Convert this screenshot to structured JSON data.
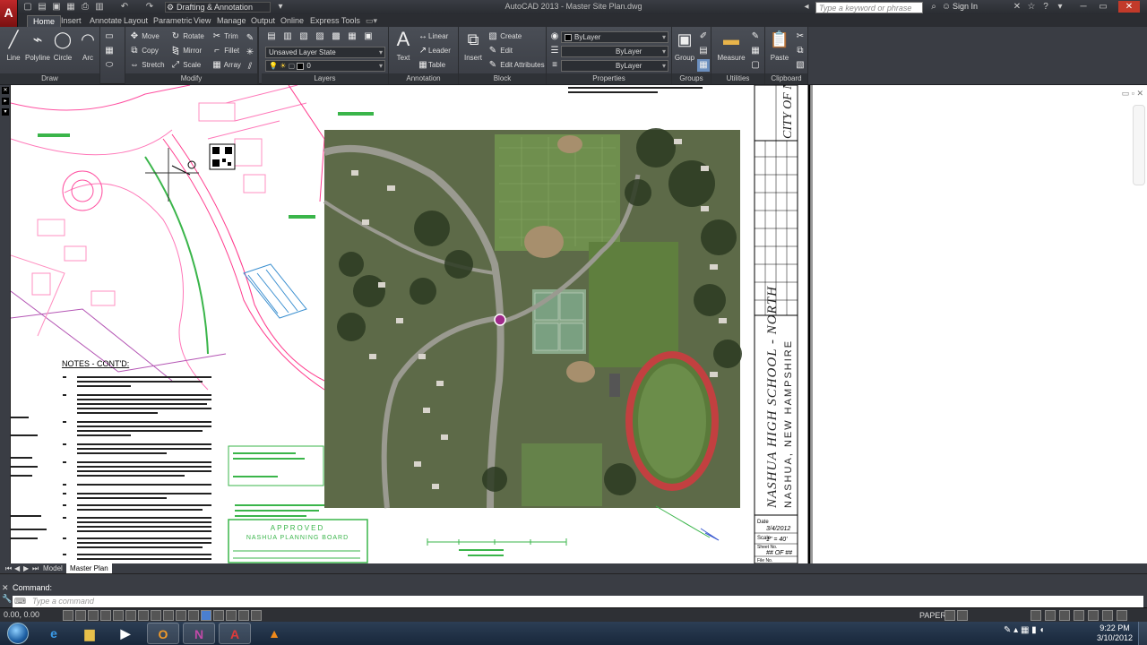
{
  "window": {
    "app_logo": "A",
    "workspace": "Drafting & Annotation",
    "title": "AutoCAD 2013 - Master Site Plan.dwg",
    "search_placeholder": "Type a keyword or phrase",
    "sign_in": "Sign In"
  },
  "tabs": [
    "Home",
    "Insert",
    "Annotate",
    "Layout",
    "Parametric",
    "View",
    "Manage",
    "Output",
    "Online",
    "Express Tools"
  ],
  "ribbon": {
    "draw": {
      "title": "Draw",
      "line": "Line",
      "polyline": "Polyline",
      "circle": "Circle",
      "arc": "Arc"
    },
    "modify": {
      "title": "Modify",
      "move": "Move",
      "rotate": "Rotate",
      "trim": "Trim",
      "copy": "Copy",
      "mirror": "Mirror",
      "fillet": "Fillet",
      "stretch": "Stretch",
      "scale": "Scale",
      "array": "Array"
    },
    "layers": {
      "title": "Layers",
      "layer_state": "Unsaved Layer State",
      "current_layer": "0"
    },
    "annotation": {
      "title": "Annotation",
      "text": "Text",
      "linear": "Linear",
      "leader": "Leader",
      "table": "Table"
    },
    "block": {
      "title": "Block",
      "insert": "Insert",
      "create": "Create",
      "edit": "Edit",
      "edit_attributes": "Edit Attributes"
    },
    "properties": {
      "title": "Properties",
      "color": "ByLayer",
      "linetype": "ByLayer",
      "lineweight": "ByLayer"
    },
    "groups": {
      "title": "Groups",
      "group": "Group"
    },
    "utilities": {
      "title": "Utilities",
      "measure": "Measure"
    },
    "clipboard": {
      "title": "Clipboard",
      "paste": "Paste"
    }
  },
  "drawing": {
    "notes_title": "NOTES - CONT'D:",
    "approval_line1": "APPROVED",
    "approval_line2": "NASHUA PLANNING BOARD",
    "title_block_main": "NASHUA HIGH SCHOOL - NORTH",
    "title_block_sub": "NASHUA, NEW HAMPSHIRE",
    "title_block_top": "CITY OF NASHUA SCHOOL BUILDING",
    "date_label": "Date",
    "date_value": "3/4/2012",
    "scale_label": "Scale",
    "scale_value": "1\" = 40'",
    "sheet_label": "Sheet No.",
    "sheet_value": "## OF ##",
    "file_label": "File No."
  },
  "layout_tabs": [
    "Model",
    "Master Plan"
  ],
  "command": {
    "history": "Command:",
    "placeholder": "Type a command"
  },
  "status": {
    "coords": "0.00, 0.00",
    "paper": "PAPER"
  },
  "taskbar": {
    "time": "9:22 PM",
    "date": "3/10/2012"
  }
}
